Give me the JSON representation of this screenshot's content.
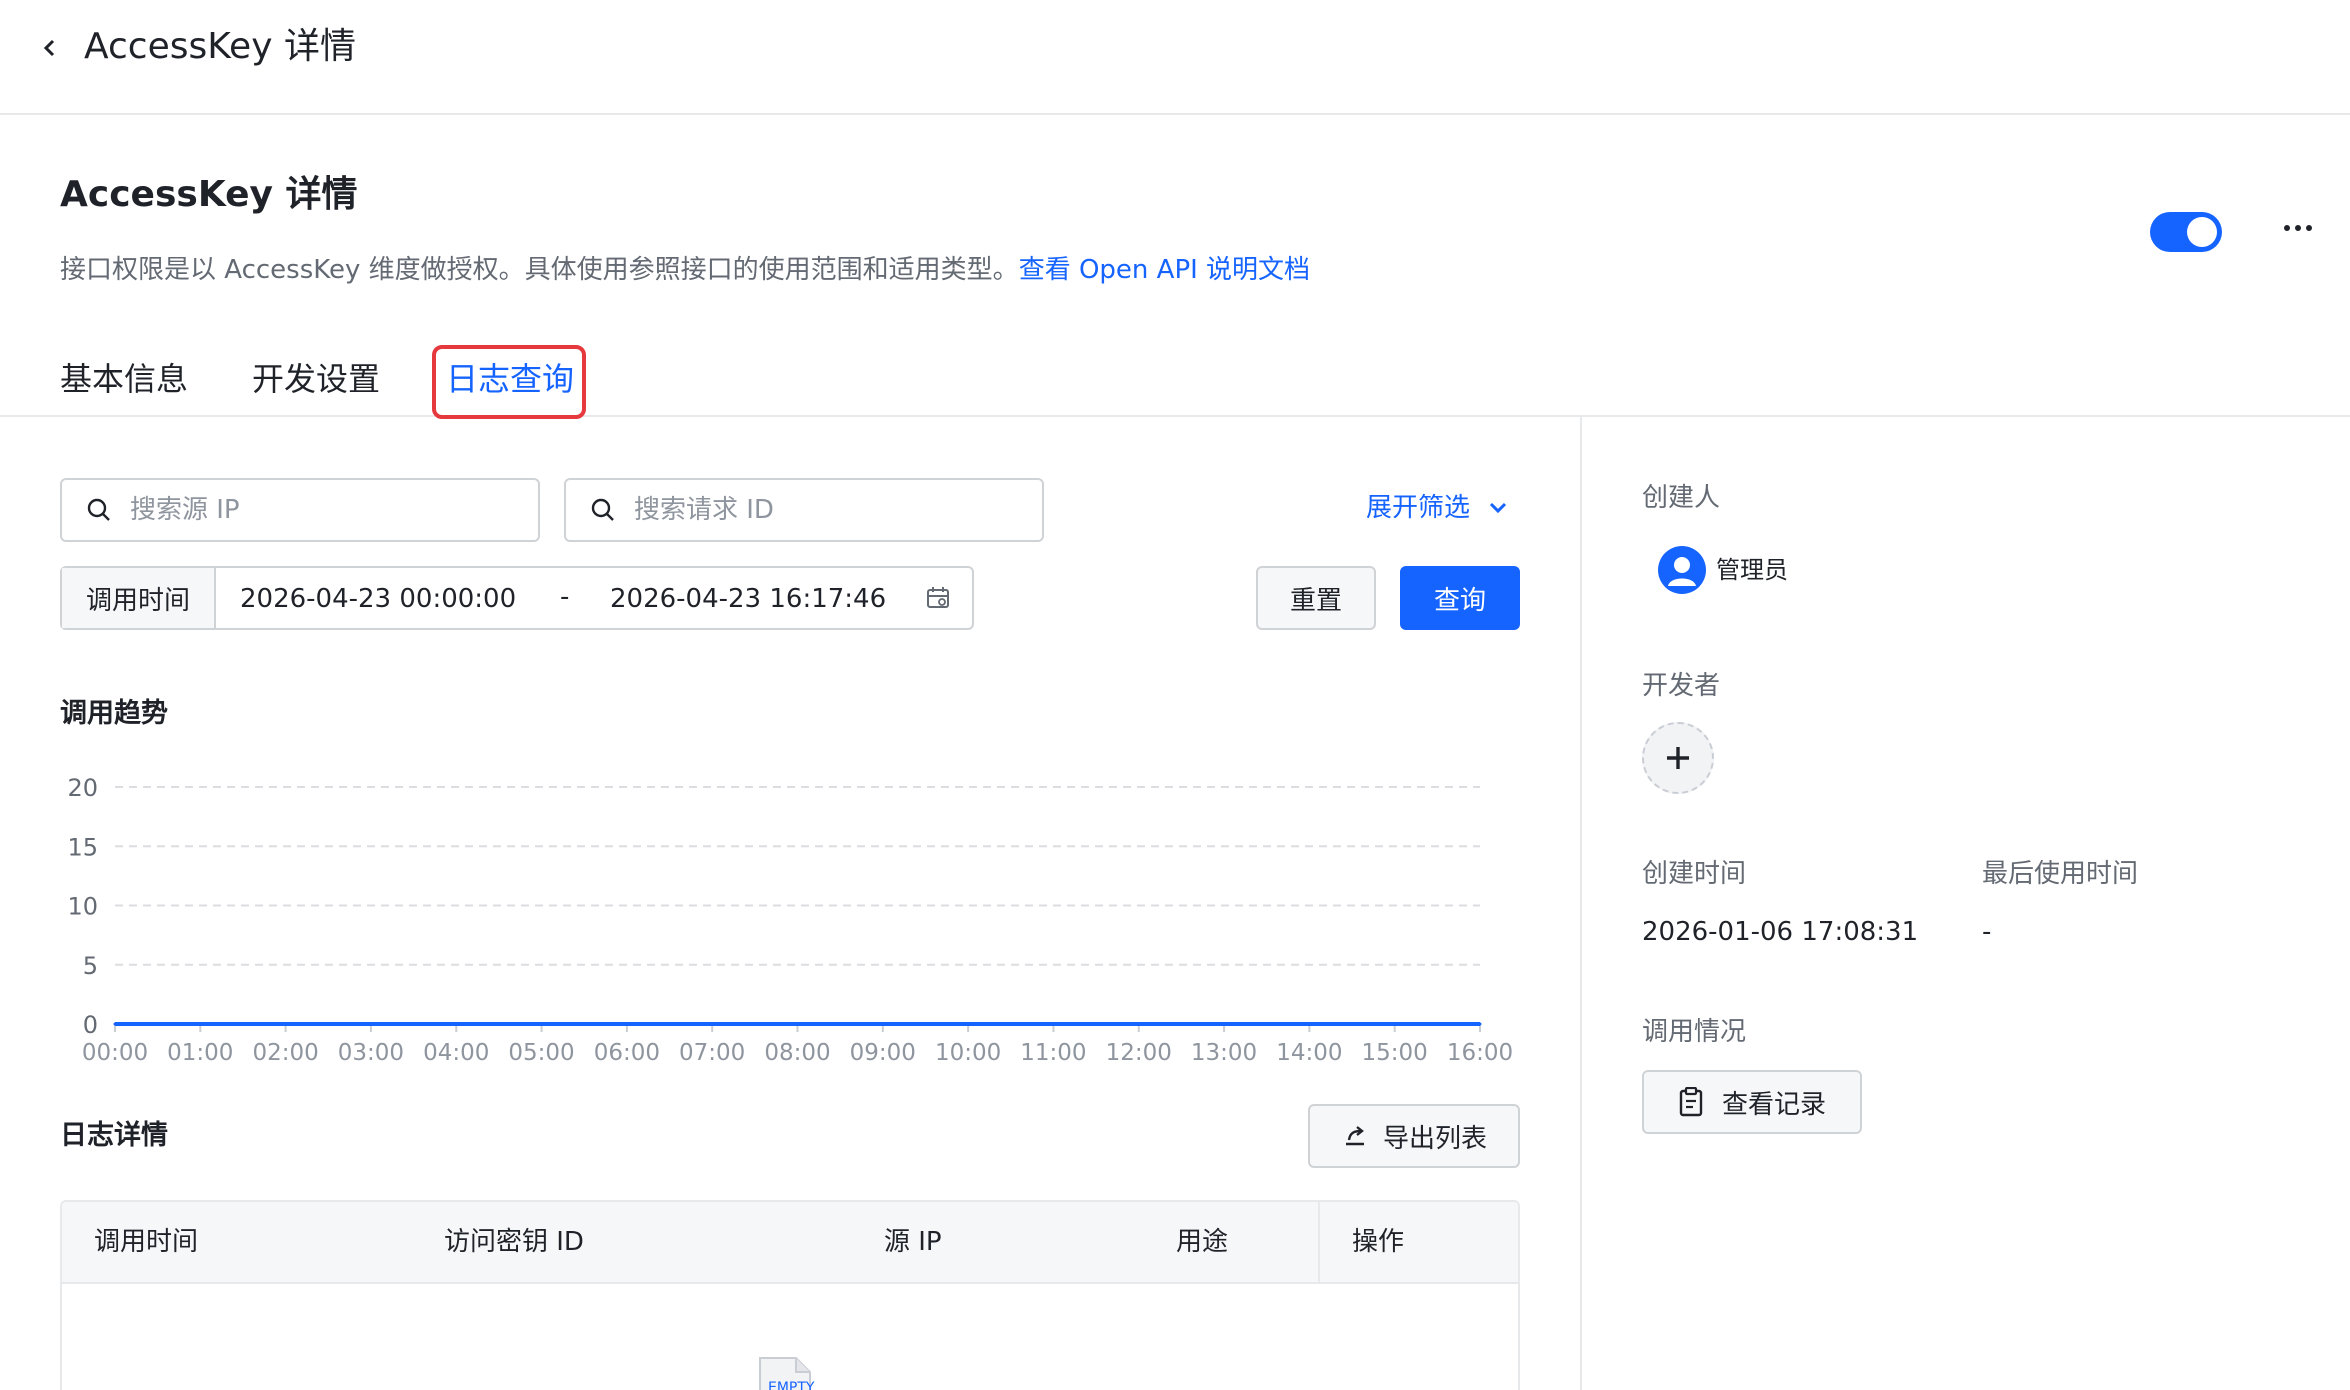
{
  "topbar": {
    "title": "AccessKey 详情"
  },
  "header": {
    "title": "AccessKey 详情",
    "description": "接口权限是以 AccessKey 维度做授权。具体使用参照接口的使用范围和适用类型。",
    "doc_link": "查看 Open API 说明文档",
    "enabled": true
  },
  "tabs": [
    {
      "label": "基本信息"
    },
    {
      "label": "开发设置"
    },
    {
      "label": "日志查询",
      "active": true
    }
  ],
  "filters": {
    "source_ip_placeholder": "搜索源 IP",
    "request_id_placeholder": "搜索请求 ID",
    "expand_label": "展开筛选",
    "time_label": "调用时间",
    "start_time": "2026-04-23 00:00:00",
    "separator": "-",
    "end_time": "2026-04-23 16:17:46",
    "reset_label": "重置",
    "query_label": "查询"
  },
  "trend": {
    "title": "调用趋势"
  },
  "chart_data": {
    "type": "line",
    "x": [
      "00:00",
      "01:00",
      "02:00",
      "03:00",
      "04:00",
      "05:00",
      "06:00",
      "07:00",
      "08:00",
      "09:00",
      "10:00",
      "11:00",
      "12:00",
      "13:00",
      "14:00",
      "15:00",
      "16:00"
    ],
    "series": [
      {
        "values": [
          0,
          0,
          0,
          0,
          0,
          0,
          0,
          0,
          0,
          0,
          0,
          0,
          0,
          0,
          0,
          0,
          0
        ]
      }
    ],
    "yticks": [
      "0",
      "5",
      "10",
      "15",
      "20"
    ],
    "ylim": [
      0,
      20
    ],
    "grid": true,
    "line_color": "#1664ff"
  },
  "logs": {
    "title": "日志详情",
    "export_label": "导出列表",
    "columns": [
      "调用时间",
      "访问密钥 ID",
      "源 IP",
      "用途",
      "操作"
    ],
    "empty_text": "EMPTY"
  },
  "sidebar": {
    "creator_label": "创建人",
    "creator_name": "管理员",
    "developer_label": "开发者",
    "created_time_label": "创建时间",
    "created_time": "2026-01-06 17:08:31",
    "last_used_label": "最后使用时间",
    "last_used": "-",
    "usage_label": "调用情况",
    "view_records_label": "查看记录"
  },
  "colors": {
    "primary": "#1664ff",
    "highlight": "#e5393e"
  }
}
